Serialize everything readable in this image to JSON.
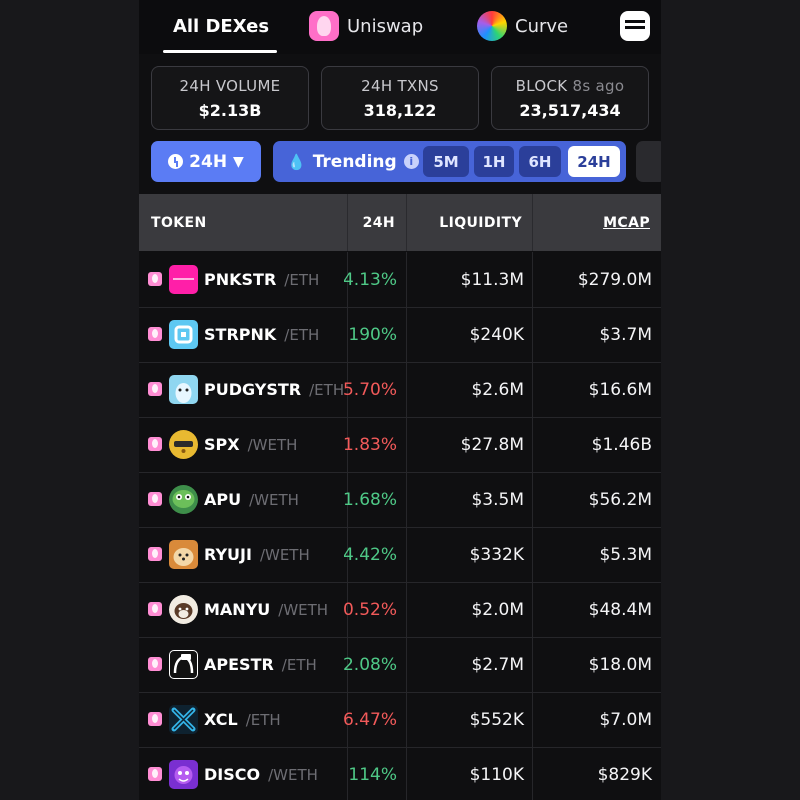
{
  "tabs": {
    "all": "All DEXes",
    "uniswap": "Uniswap",
    "curve": "Curve",
    "more": "I"
  },
  "stats": {
    "volume_label": "24H VOLUME",
    "volume_value": "$2.13B",
    "txns_label": "24H TXNS",
    "txns_value": "318,122",
    "block_label": "BLOCK",
    "block_ago": "8s ago",
    "block_value": "23,517,434"
  },
  "filters": {
    "timeframe": "24H",
    "trending_label": "Trending",
    "info": "i",
    "options": [
      "5M",
      "1H",
      "6H",
      "24H"
    ],
    "selected": "24H"
  },
  "table": {
    "headers": {
      "token": "TOKEN",
      "change": "24H",
      "liquidity": "LIQUIDITY",
      "mcap": "MCAP"
    },
    "rows": [
      {
        "symbol": "PNKSTR",
        "pair": "/ETH",
        "change": "4.13%",
        "dir": "up",
        "liquidity": "$11.3M",
        "mcap": "$279.0M",
        "icon": "pnkstr-icon"
      },
      {
        "symbol": "STRPNK",
        "pair": "/ETH",
        "change": "190%",
        "dir": "up",
        "liquidity": "$240K",
        "mcap": "$3.7M",
        "icon": "strpnk-icon"
      },
      {
        "symbol": "PUDGYSTR",
        "pair": "/ETH",
        "change": "5.70%",
        "dir": "down",
        "liquidity": "$2.6M",
        "mcap": "$16.6M",
        "icon": "pudgystr-icon"
      },
      {
        "symbol": "SPX",
        "pair": "/WETH",
        "change": "1.83%",
        "dir": "down",
        "liquidity": "$27.8M",
        "mcap": "$1.46B",
        "icon": "spx-icon"
      },
      {
        "symbol": "APU",
        "pair": "/WETH",
        "change": "1.68%",
        "dir": "up",
        "liquidity": "$3.5M",
        "mcap": "$56.2M",
        "icon": "apu-icon"
      },
      {
        "symbol": "RYUJI",
        "pair": "/WETH",
        "change": "4.42%",
        "dir": "up",
        "liquidity": "$332K",
        "mcap": "$5.3M",
        "icon": "ryuji-icon"
      },
      {
        "symbol": "MANYU",
        "pair": "/WETH",
        "change": "0.52%",
        "dir": "down",
        "liquidity": "$2.0M",
        "mcap": "$48.4M",
        "icon": "manyu-icon"
      },
      {
        "symbol": "APESTR",
        "pair": "/ETH",
        "change": "2.08%",
        "dir": "up",
        "liquidity": "$2.7M",
        "mcap": "$18.0M",
        "icon": "apestr-icon"
      },
      {
        "symbol": "XCL",
        "pair": "/ETH",
        "change": "6.47%",
        "dir": "down",
        "liquidity": "$552K",
        "mcap": "$7.0M",
        "icon": "xcl-icon"
      },
      {
        "symbol": "DISCO",
        "pair": "/WETH",
        "change": "114%",
        "dir": "up",
        "liquidity": "$110K",
        "mcap": "$829K",
        "icon": "disco-icon"
      }
    ]
  },
  "colors": {
    "accent": "#5b7cf4",
    "trending_bg": "#4764d8",
    "positive": "#4fc987",
    "negative": "#f25a5a",
    "header_bg": "#3a3a3e",
    "uniswap_pink": "#ff6fc8"
  }
}
